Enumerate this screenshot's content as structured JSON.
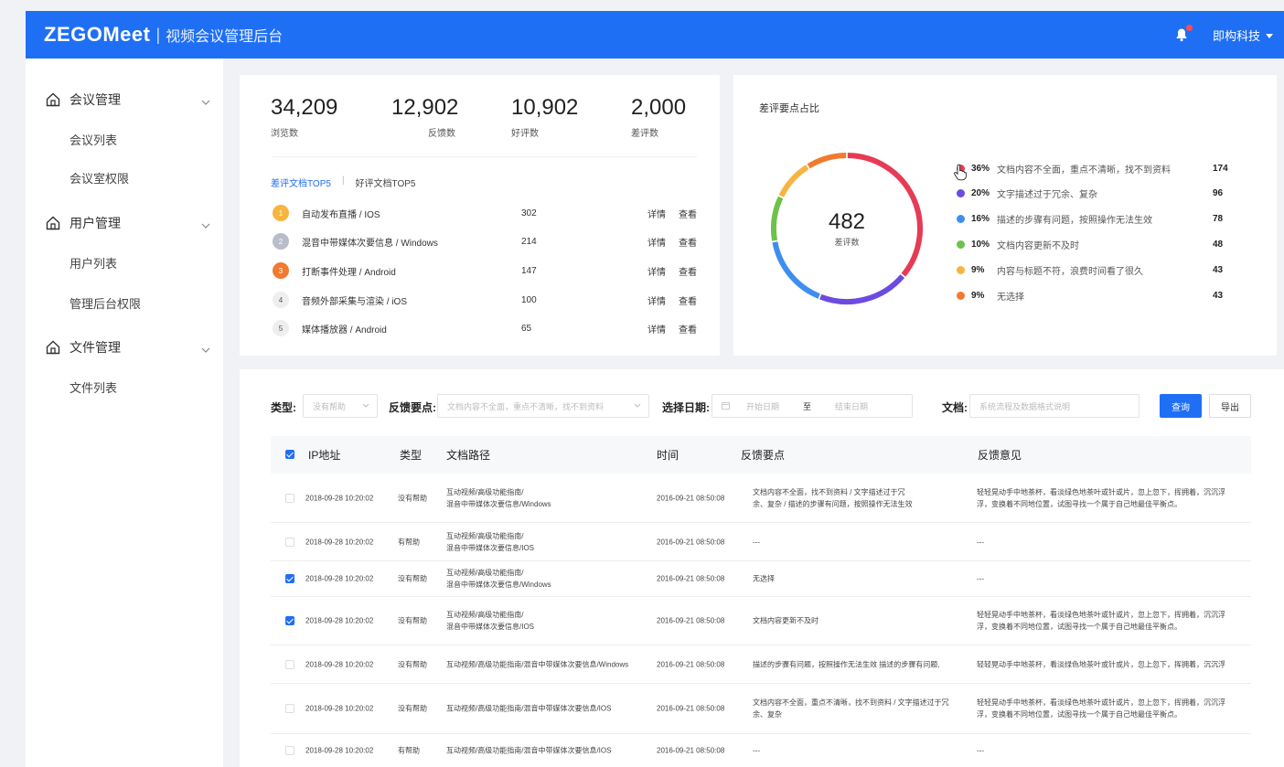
{
  "header": {
    "brand": "ZEGOMeet",
    "separator": "|",
    "subtitle": "视频会议管理后台",
    "user": "即构科技"
  },
  "sidebar": {
    "groups": [
      {
        "label": "会议管理",
        "icon": "home-icon",
        "items": [
          "会议列表",
          "会议室权限"
        ]
      },
      {
        "label": "用户管理",
        "icon": "home-icon",
        "items": [
          "用户列表",
          "管理后台权限"
        ]
      },
      {
        "label": "文件管理",
        "icon": "home-icon",
        "items": [
          "文件列表"
        ]
      }
    ]
  },
  "stats": [
    {
      "value": "34,209",
      "label": "浏览数"
    },
    {
      "value": "12,902",
      "label": "反馈数"
    },
    {
      "value": "10,902",
      "label": "好评数"
    },
    {
      "value": "2,000",
      "label": "差评数"
    }
  ],
  "top_tabs": {
    "active": "差评文档TOP5",
    "separator": "|",
    "inactive": "好评文档TOP5"
  },
  "top_rows": [
    {
      "rank": "1",
      "name": "自动发布直播 / IOS",
      "count": "302",
      "detail": "详情",
      "view": "查看",
      "color": "#f5b53f"
    },
    {
      "rank": "2",
      "name": "混音中带媒体次要信息 / Windows",
      "count": "214",
      "detail": "详情",
      "view": "查看",
      "color": "#b8bdca"
    },
    {
      "rank": "3",
      "name": "打断事件处理 / Android",
      "count": "147",
      "detail": "详情",
      "view": "查看",
      "color": "#f27a2e"
    },
    {
      "rank": "4",
      "name": "音频外部采集与渲染 / iOS",
      "count": "100",
      "detail": "详情",
      "view": "查看",
      "color": "#eeeeee"
    },
    {
      "rank": "5",
      "name": "媒体播放器 / Android",
      "count": "65",
      "detail": "详情",
      "view": "查看",
      "color": "#eeeeee"
    }
  ],
  "pie": {
    "title": "差评要点占比",
    "total": "482",
    "total_label": "差评数"
  },
  "chart_data": {
    "type": "pie",
    "title": "差评要点占比",
    "categories": [
      "文档内容不全面，重点不清晰，找不到资料",
      "文字描述过于冗余、复杂",
      "描述的步骤有问题，按照操作无法生效",
      "文档内容更新不及时",
      "内容与标题不符，浪费时间看了很久",
      "无选择"
    ],
    "percent_labels": [
      "36%",
      "20%",
      "16%",
      "10%",
      "9%",
      "9%"
    ],
    "values": [
      174,
      96,
      78,
      48,
      43,
      43
    ],
    "colors": [
      "#e63b55",
      "#6b4be0",
      "#3e8ef0",
      "#6cc24a",
      "#f5b53f",
      "#f27a2e"
    ]
  },
  "filters": {
    "type_label": "类型:",
    "type_value": "没有帮助",
    "point_label": "反馈要点:",
    "point_value": "文档内容不全面，重点不清晰，找不到资料",
    "date_label": "选择日期:",
    "start_placeholder": "开始日期",
    "to": "至",
    "end_placeholder": "结束日期",
    "doc_label": "文档:",
    "doc_placeholder": "系统流程及数据格式说明",
    "query": "查询",
    "export": "导出"
  },
  "table": {
    "headers": [
      "IP地址",
      "类型",
      "文档路径",
      "时间",
      "反馈要点",
      "反馈意见"
    ],
    "rows": [
      {
        "checked": false,
        "ip": "2018-09-28 10:20:02",
        "type": "没有帮助",
        "path1": "互动视频/高级功能指南/",
        "path2": "混音中带媒体次要信息/Windows",
        "time": "2016-09-21 08:50:08",
        "point1": "文档内容不全面，找不到资料 / 文字描述过于冗",
        "point2": "余、复杂 / 描述的步骤有问题，按照操作无法生效",
        "opinion1": "轻轻晃动手中地茶杯，看淡绿色地茶叶或针或片，忽上忽下，挥拥着，沉沉浮",
        "opinion2": "浮，变换着不同地位置，试图寻找一个属于自己地最佳平衡点。"
      },
      {
        "checked": false,
        "ip": "2018-09-28 10:20:02",
        "type": "有帮助",
        "path1": "互动视频/高级功能指南/",
        "path2": "混音中带媒体次要信息/IOS",
        "time": "2016-09-21 08:50:08",
        "point1": "---",
        "point2": "",
        "opinion1": "---",
        "opinion2": ""
      },
      {
        "checked": true,
        "ip": "2018-09-28 10:20:02",
        "type": "没有帮助",
        "path1": "互动视频/高级功能指南/",
        "path2": "混音中带媒体次要信息/Windows",
        "time": "2016-09-21 08:50:08",
        "point1": "无选择",
        "point2": "",
        "opinion1": "---",
        "opinion2": ""
      },
      {
        "checked": true,
        "ip": "2018-09-28 10:20:02",
        "type": "没有帮助",
        "path1": "互动视频/高级功能指南/",
        "path2": "混音中带媒体次要信息/IOS",
        "time": "2016-09-21 08:50:08",
        "point1": "文档内容更新不及时",
        "point2": "",
        "opinion1": "轻轻晃动手中地茶杯，看淡绿色地茶叶或针或片，忽上忽下，挥拥着，沉沉浮",
        "opinion2": "浮，变换着不同地位置，试图寻找一个属于自己地最佳平衡点。"
      },
      {
        "checked": false,
        "ip": "2018-09-28 10:20:02",
        "type": "没有帮助",
        "path1": "互动视频/高级功能指南/混音中带媒体次要信息/Windows",
        "path2": "",
        "time": "2016-09-21 08:50:08",
        "point1": "描述的步骤有问题，按照操作无法生效 描述的步骤有问题,",
        "point2": "",
        "opinion1": "轻轻晃动手中地茶杯，看淡绿色地茶叶或针或片，忽上忽下，挥拥着，沉沉浮",
        "opinion2": ""
      },
      {
        "checked": false,
        "ip": "2018-09-28 10:20:02",
        "type": "没有帮助",
        "path1": "互动视频/高级功能指南/混音中带媒体次要信息/IOS",
        "path2": "",
        "time": "2016-09-21 08:50:08",
        "point1": "文档内容不全面，重点不清晰，找不到资料 / 文字描述过于冗",
        "point2": "余、复杂",
        "opinion1": "轻轻晃动手中地茶杯，看淡绿色地茶叶或针或片，忽上忽下，挥拥着，沉沉浮",
        "opinion2": "浮，变换着不同地位置，试图寻找一个属于自己地最佳平衡点。"
      },
      {
        "checked": false,
        "ip": "2018-09-28 10:20:02",
        "type": "有帮助",
        "path1": "互动视频/高级功能指南/混音中带媒体次要信息/IOS",
        "path2": "",
        "time": "2016-09-21 08:50:08",
        "point1": "---",
        "point2": "",
        "opinion1": "---",
        "opinion2": ""
      }
    ]
  }
}
